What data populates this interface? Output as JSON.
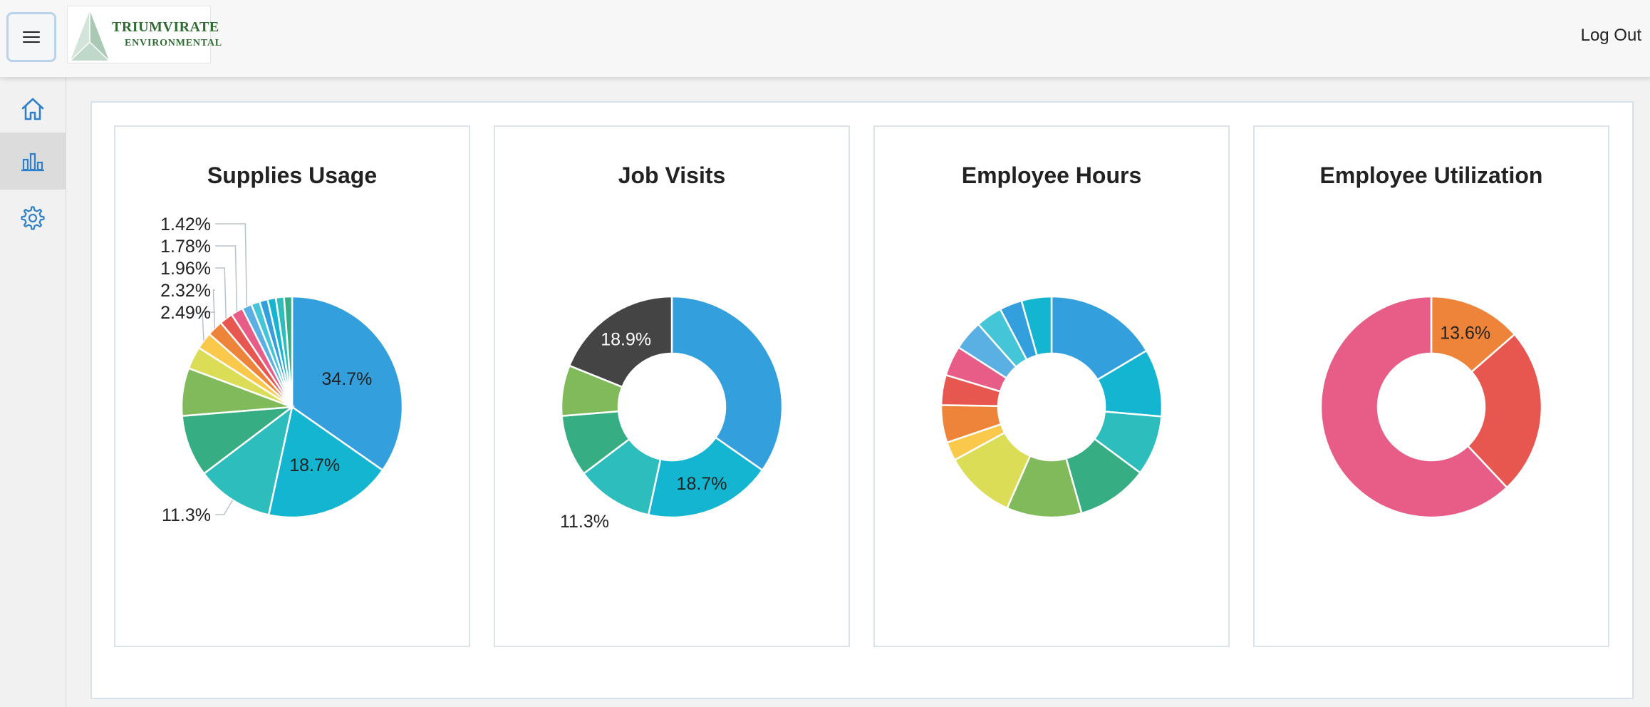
{
  "header": {
    "menu_icon": "hamburger-icon",
    "logo_line1": "TRIUMVIRATE",
    "logo_line2": "ENVIRONMENTAL",
    "logout_label": "Log Out"
  },
  "sidebar": {
    "items": [
      {
        "name": "home",
        "icon": "home-icon",
        "active": false
      },
      {
        "name": "charts",
        "icon": "bar-chart-icon",
        "active": true
      },
      {
        "name": "settings",
        "icon": "gear-icon",
        "active": false
      }
    ]
  },
  "colors": {
    "accent": "#2f80c8",
    "palette": [
      "#339fdd",
      "#13b5d1",
      "#2ebdbd",
      "#37ad83",
      "#80ba5b",
      "#dadd55",
      "#fac84b",
      "#ee843a",
      "#e8574f",
      "#e85d87",
      "#5ab0e2",
      "#44c6d8"
    ]
  },
  "chart_data": [
    {
      "type": "pie",
      "title": "Supplies Usage",
      "values": [
        34.7,
        18.7,
        11.3,
        9.0,
        7.0,
        3.3,
        2.49,
        2.32,
        1.96,
        1.78,
        1.42,
        1.26,
        1.2,
        1.2,
        1.2,
        1.17
      ],
      "colors": [
        "#339fdd",
        "#13b5d1",
        "#2ebdbd",
        "#37ad83",
        "#80ba5b",
        "#dadd55",
        "#fac84b",
        "#ee843a",
        "#e8574f",
        "#e85d87",
        "#5ab0e2",
        "#44c6d8",
        "#339fdd",
        "#13b5d1",
        "#2ebdbd",
        "#37ad83"
      ],
      "inner_labels": [
        {
          "index": 0,
          "text": "34.7%"
        },
        {
          "index": 1,
          "text": "18.7%"
        }
      ],
      "outer_labels": [
        {
          "index": 2,
          "text": "11.3%"
        },
        {
          "index": 6,
          "text": "2.49%"
        },
        {
          "index": 7,
          "text": "2.32%"
        },
        {
          "index": 8,
          "text": "1.96%"
        },
        {
          "index": 9,
          "text": "1.78%"
        },
        {
          "index": 10,
          "text": "1.42%"
        }
      ]
    },
    {
      "type": "pie",
      "donut": true,
      "title": "Job Visits",
      "values": [
        34.7,
        18.7,
        11.3,
        9.0,
        7.4,
        18.9
      ],
      "colors": [
        "#339fdd",
        "#13b5d1",
        "#2ebdbd",
        "#37ad83",
        "#80ba5b",
        "#444444"
      ],
      "inner_labels": [
        {
          "index": 1,
          "text": "18.7%"
        },
        {
          "index": 5,
          "text": "18.9%"
        }
      ],
      "outer_labels": [
        {
          "index": 2,
          "text": "11.3%"
        }
      ]
    },
    {
      "type": "pie",
      "donut": true,
      "title": "Employee Hours",
      "values": [
        15.0,
        9.0,
        8.0,
        9.5,
        10.0,
        9.5,
        2.5,
        5.0,
        4.0,
        4.0,
        4.0,
        3.5,
        3.0,
        4.0
      ],
      "colors": [
        "#339fdd",
        "#13b5d1",
        "#2ebdbd",
        "#37ad83",
        "#80ba5b",
        "#dadd55",
        "#fac84b",
        "#ee843a",
        "#e8574f",
        "#e85d87",
        "#5ab0e2",
        "#44c6d8",
        "#339fdd",
        "#13b5d1"
      ],
      "inner_labels": [],
      "outer_labels": []
    },
    {
      "type": "pie",
      "donut": true,
      "title": "Employee Utilization",
      "values": [
        13.6,
        24.4,
        62.0
      ],
      "colors": [
        "#ee843a",
        "#e8574f",
        "#e85d87"
      ],
      "inner_labels": [
        {
          "index": 0,
          "text": "13.6%"
        }
      ],
      "outer_labels": []
    }
  ]
}
